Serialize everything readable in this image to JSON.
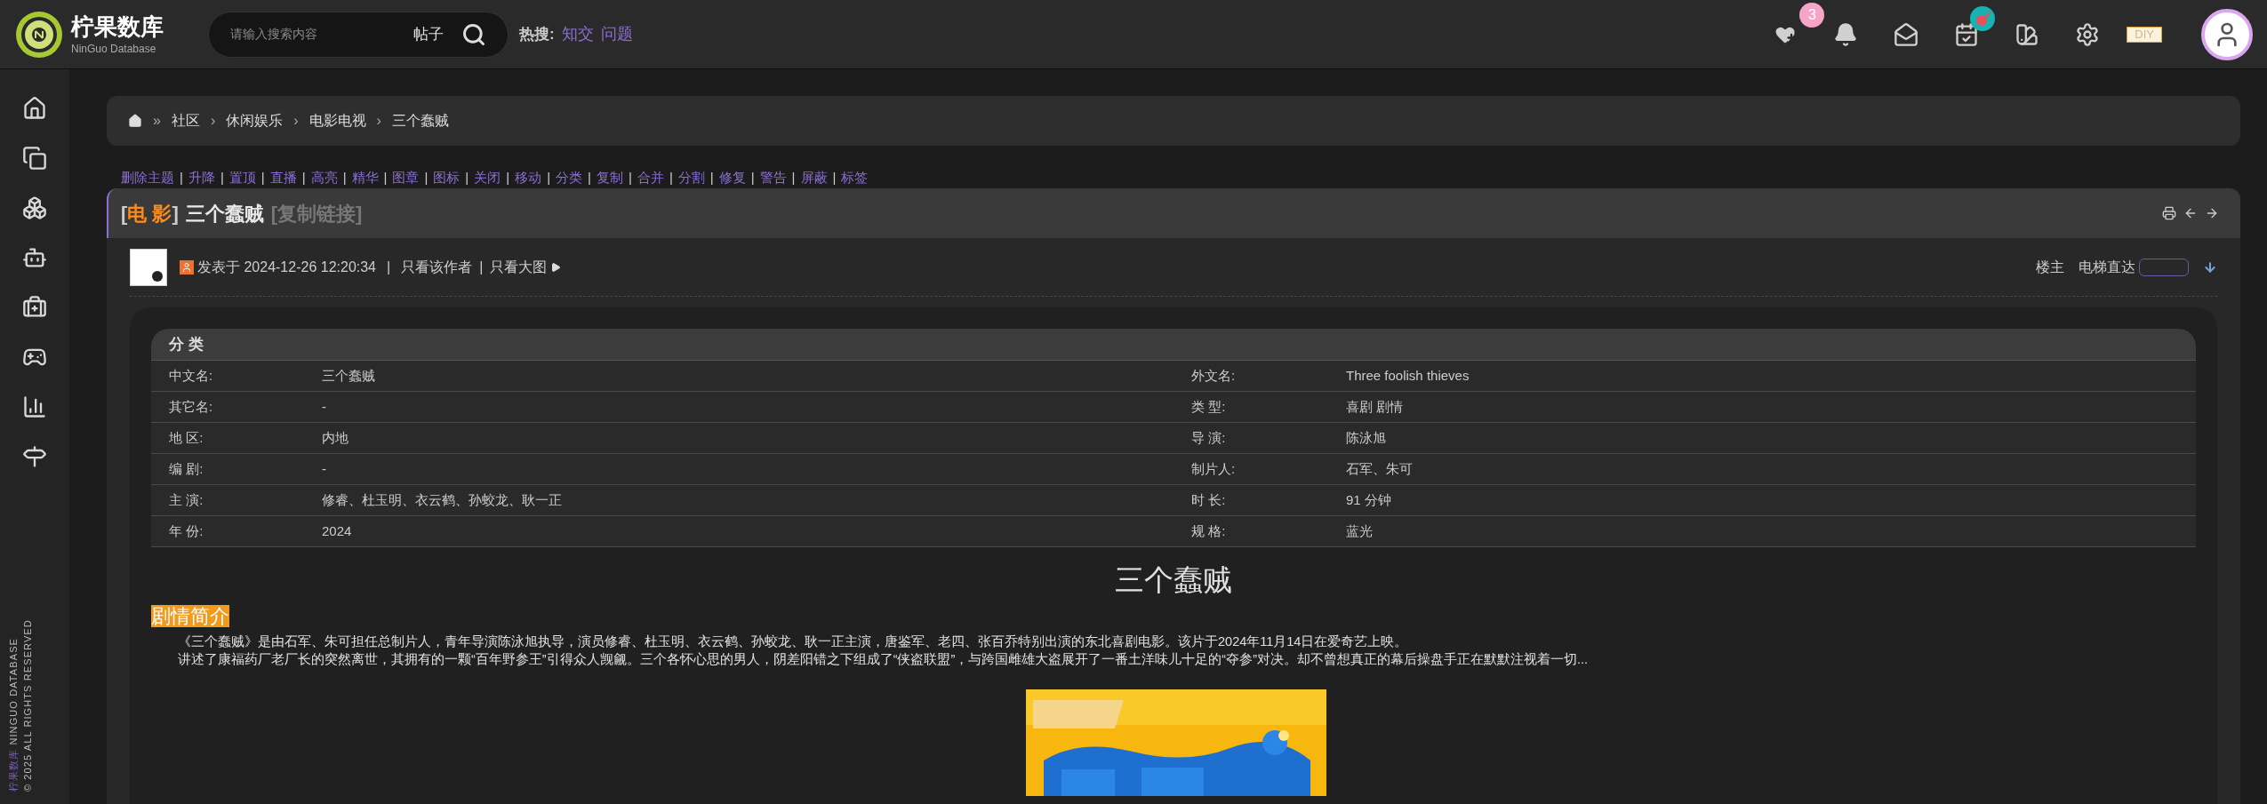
{
  "brand": {
    "name": "柠果数库",
    "subtitle": "NinGuo Database"
  },
  "search": {
    "placeholder": "请输入搜索内容",
    "scope": "帖子"
  },
  "hot_search": {
    "label": "热搜:",
    "links": [
      "知交",
      "问题"
    ]
  },
  "header_icons": [
    {
      "kind": "favorites",
      "badge": "3"
    },
    {
      "kind": "bell"
    },
    {
      "kind": "mail"
    },
    {
      "kind": "calendar",
      "badge_picture": true
    },
    {
      "kind": "palette"
    },
    {
      "kind": "settings"
    }
  ],
  "diy": "DIY",
  "sidebar_footer": {
    "brand": "柠果数库",
    "name": "NINGUO DATABASE",
    "rights": "© 2025 ALL RIGHTS RESERVED"
  },
  "breadcrumb": [
    {
      "sep": "»",
      "label": "社区"
    },
    {
      "sep": "›",
      "label": "休闲娱乐"
    },
    {
      "sep": "›",
      "label": "电影电视"
    },
    {
      "sep": "›",
      "label": "三个蠢贼"
    }
  ],
  "mod_actions": {
    "separator": "|",
    "items": [
      "删除主题",
      "升降",
      "置顶",
      "直播",
      "高亮",
      "精华",
      "图章",
      "图标",
      "关闭",
      "移动",
      "分类",
      "复制",
      "合并",
      "分割",
      "修复",
      "警告",
      "屏蔽",
      "标签"
    ]
  },
  "thread": {
    "open": "[",
    "category": "电 影",
    "close": "]",
    "title": "三个蠢贼",
    "copy_link": "[复制链接]"
  },
  "post_meta": {
    "posted": "发表于 2024-12-26 12:20:34",
    "sep": "|",
    "only_author": "只看该作者",
    "sep_2": "|",
    "big_image": "只看大图",
    "floor": "楼主",
    "elevator": "电梯直达"
  },
  "info_table": {
    "heading": "分 类",
    "rows": [
      {
        "label": "中文名:",
        "value": "三个蠢贼",
        "label_2": "外文名:",
        "value_2": "Three foolish thieves"
      },
      {
        "label": "其它名:",
        "value": "-",
        "label_2": "类 型:",
        "value_2": "喜剧 剧情"
      },
      {
        "label": "地 区:",
        "value": "内地",
        "label_2": "导 演:",
        "value_2": "陈泳旭"
      },
      {
        "label": "编 剧:",
        "value": "-",
        "label_2": "制片人:",
        "value_2": "石军、朱可"
      },
      {
        "label": "主 演:",
        "value": "修睿、杜玉明、衣云鹤、孙蛟龙、耿一正",
        "label_2": "时 长:",
        "value_2": "91 分钟"
      },
      {
        "label": "年 份:",
        "value": "2024",
        "label_2": "规 格:",
        "value_2": "蓝光"
      }
    ]
  },
  "movie_title": "三个蠢贼",
  "synopsis_heading": "剧情简介",
  "paragraphs": [
    "《三个蠢贼》是由石军、朱可担任总制片人，青年导演陈泳旭执导，演员修睿、杜玉明、衣云鹤、孙蛟龙、耿一正主演，唐鉴军、老四、张百乔特别出演的东北喜剧电影。该片于2024年11月14日在爱奇艺上映。",
    "讲述了康福药厂老厂长的突然离世，其拥有的一颗“百年野参王”引得众人觊觎。三个各怀心思的男人，阴差阳错之下组成了“侠盗联盟”，与跨国雌雄大盗展开了一番土洋味儿十足的“夺参”对决。却不曾想真正的幕后操盘手正在默默注视着一切..."
  ]
}
